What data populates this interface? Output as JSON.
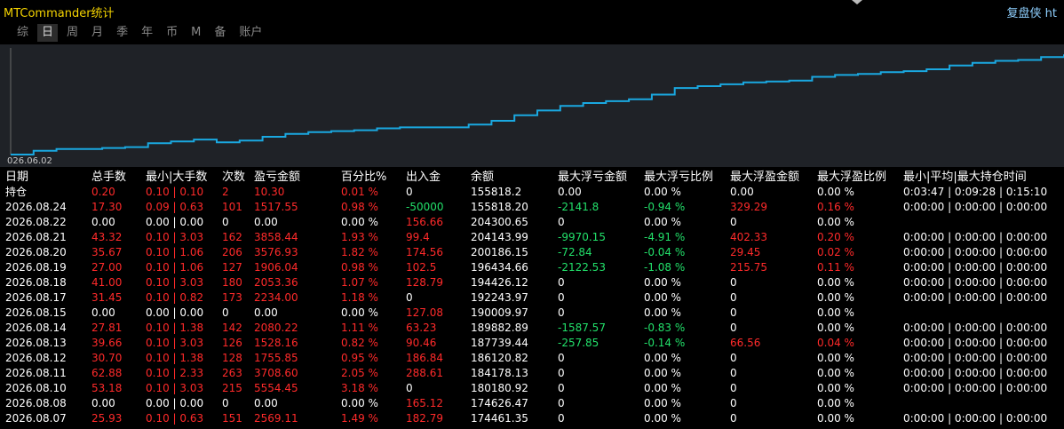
{
  "app": {
    "title": "MTCommander统计",
    "brand": "复盘侠 ht"
  },
  "tabs": [
    {
      "label": "综",
      "active": false
    },
    {
      "label": "日",
      "active": true
    },
    {
      "label": "周",
      "active": false
    },
    {
      "label": "月",
      "active": false
    },
    {
      "label": "季",
      "active": false
    },
    {
      "label": "年",
      "active": false
    },
    {
      "label": "币",
      "active": false
    },
    {
      "label": "M",
      "active": false
    },
    {
      "label": "备",
      "active": false
    },
    {
      "label": "账户",
      "active": false
    }
  ],
  "chart_data": {
    "type": "line",
    "x_start_label": "026.06.02",
    "line_color": "#1aa8e0",
    "background": "#1f2227",
    "values": [
      0,
      4,
      6,
      6,
      7,
      8,
      12,
      14,
      16,
      13,
      15,
      19,
      22,
      24,
      25,
      26,
      28,
      29,
      29,
      29,
      32,
      36,
      42,
      47,
      52,
      55,
      57,
      59,
      64,
      71,
      73,
      75,
      77,
      78,
      79,
      83,
      85,
      86,
      88,
      89,
      91,
      95,
      98,
      100,
      101,
      104,
      107
    ],
    "ylim": [
      0,
      110
    ]
  },
  "table": {
    "headers": [
      "日期",
      "总手数",
      "最小|大手数",
      "次数",
      "盈亏金额",
      "百分比%",
      "出入金",
      "余额",
      "最大浮亏金额",
      "最大浮亏比例",
      "最大浮盈金额",
      "最大浮盈比例",
      "最小|平均|最大持仓时间"
    ],
    "colors": {
      "red": "#ff2a2a",
      "green": "#22e06a",
      "white": "#ffffff"
    },
    "rows": [
      {
        "cells": [
          "持仓",
          "0.20",
          "0.10 | 0.10",
          "2",
          "10.30",
          "0.01 %",
          "0",
          "155818.2",
          "0.00",
          "0.00 %",
          "0.00",
          "0.00 %",
          "0:03:47 | 0:09:28 | 0:15:10"
        ],
        "tones": [
          "white",
          "red",
          "red",
          "red",
          "red",
          "red",
          "white",
          "white",
          "white",
          "white",
          "white",
          "white",
          "white"
        ]
      },
      {
        "cells": [
          "2026.08.24",
          "17.30",
          "0.09 | 0.63",
          "101",
          "1517.55",
          "0.98 %",
          "-50000",
          "155818.20",
          "-2141.8",
          "-0.94 %",
          "329.29",
          "0.16 %",
          "0:00:00 | 0:00:00 | 0:00:00"
        ],
        "tones": [
          "white",
          "red",
          "red",
          "red",
          "red",
          "red",
          "green",
          "white",
          "green",
          "green",
          "red",
          "red",
          "white"
        ]
      },
      {
        "cells": [
          "2026.08.22",
          "0.00",
          "0.00 | 0.00",
          "0",
          "0.00",
          "0.00 %",
          "156.66",
          "204300.65",
          "0",
          "0.00 %",
          "0",
          "0.00 %",
          ""
        ],
        "tones": [
          "white",
          "white",
          "white",
          "white",
          "white",
          "white",
          "red",
          "white",
          "white",
          "white",
          "white",
          "white",
          "white"
        ]
      },
      {
        "cells": [
          "2026.08.21",
          "43.32",
          "0.10 | 3.03",
          "162",
          "3858.44",
          "1.93 %",
          "99.4",
          "204143.99",
          "-9970.15",
          "-4.91 %",
          "402.33",
          "0.20 %",
          "0:00:00 | 0:00:00 | 0:00:00"
        ],
        "tones": [
          "white",
          "red",
          "red",
          "red",
          "red",
          "red",
          "red",
          "white",
          "green",
          "green",
          "red",
          "red",
          "white"
        ]
      },
      {
        "cells": [
          "2026.08.20",
          "35.67",
          "0.10 | 1.06",
          "206",
          "3576.93",
          "1.82 %",
          "174.56",
          "200186.15",
          "-72.84",
          "-0.04 %",
          "29.45",
          "0.02 %",
          "0:00:00 | 0:00:00 | 0:00:00"
        ],
        "tones": [
          "white",
          "red",
          "red",
          "red",
          "red",
          "red",
          "red",
          "white",
          "green",
          "green",
          "red",
          "red",
          "white"
        ]
      },
      {
        "cells": [
          "2026.08.19",
          "27.00",
          "0.10 | 1.06",
          "127",
          "1906.04",
          "0.98 %",
          "102.5",
          "196434.66",
          "-2122.53",
          "-1.08 %",
          "215.75",
          "0.11 %",
          "0:00:00 | 0:00:00 | 0:00:00"
        ],
        "tones": [
          "white",
          "red",
          "red",
          "red",
          "red",
          "red",
          "red",
          "white",
          "green",
          "green",
          "red",
          "red",
          "white"
        ]
      },
      {
        "cells": [
          "2026.08.18",
          "41.00",
          "0.10 | 3.03",
          "180",
          "2053.36",
          "1.07 %",
          "128.79",
          "194426.12",
          "0",
          "0.00 %",
          "0",
          "0.00 %",
          "0:00:00 | 0:00:00 | 0:00:00"
        ],
        "tones": [
          "white",
          "red",
          "red",
          "red",
          "red",
          "red",
          "red",
          "white",
          "white",
          "white",
          "white",
          "white",
          "white"
        ]
      },
      {
        "cells": [
          "2026.08.17",
          "31.45",
          "0.10 | 0.82",
          "173",
          "2234.00",
          "1.18 %",
          "0",
          "192243.97",
          "0",
          "0.00 %",
          "0",
          "0.00 %",
          "0:00:00 | 0:00:00 | 0:00:00"
        ],
        "tones": [
          "white",
          "red",
          "red",
          "red",
          "red",
          "red",
          "white",
          "white",
          "white",
          "white",
          "white",
          "white",
          "white"
        ]
      },
      {
        "cells": [
          "2026.08.15",
          "0.00",
          "0.00 | 0.00",
          "0",
          "0.00",
          "0.00 %",
          "127.08",
          "190009.97",
          "0",
          "0.00 %",
          "0",
          "0.00 %",
          ""
        ],
        "tones": [
          "white",
          "white",
          "white",
          "white",
          "white",
          "white",
          "red",
          "white",
          "white",
          "white",
          "white",
          "white",
          "white"
        ]
      },
      {
        "cells": [
          "2026.08.14",
          "27.81",
          "0.10 | 1.38",
          "142",
          "2080.22",
          "1.11 %",
          "63.23",
          "189882.89",
          "-1587.57",
          "-0.83 %",
          "0",
          "0.00 %",
          "0:00:00 | 0:00:00 | 0:00:00"
        ],
        "tones": [
          "white",
          "red",
          "red",
          "red",
          "red",
          "red",
          "red",
          "white",
          "green",
          "green",
          "white",
          "white",
          "white"
        ]
      },
      {
        "cells": [
          "2026.08.13",
          "39.66",
          "0.10 | 3.03",
          "126",
          "1528.16",
          "0.82 %",
          "90.46",
          "187739.44",
          "-257.85",
          "-0.14 %",
          "66.56",
          "0.04 %",
          "0:00:00 | 0:00:00 | 0:00:00"
        ],
        "tones": [
          "white",
          "red",
          "red",
          "red",
          "red",
          "red",
          "red",
          "white",
          "green",
          "green",
          "red",
          "red",
          "white"
        ]
      },
      {
        "cells": [
          "2026.08.12",
          "30.70",
          "0.10 | 1.38",
          "128",
          "1755.85",
          "0.95 %",
          "186.84",
          "186120.82",
          "0",
          "0.00 %",
          "0",
          "0.00 %",
          "0:00:00 | 0:00:00 | 0:00:00"
        ],
        "tones": [
          "white",
          "red",
          "red",
          "red",
          "red",
          "red",
          "red",
          "white",
          "white",
          "white",
          "white",
          "white",
          "white"
        ]
      },
      {
        "cells": [
          "2026.08.11",
          "62.88",
          "0.10 | 2.33",
          "263",
          "3708.60",
          "2.05 %",
          "288.61",
          "184178.13",
          "0",
          "0.00 %",
          "0",
          "0.00 %",
          "0:00:00 | 0:00:00 | 0:00:00"
        ],
        "tones": [
          "white",
          "red",
          "red",
          "red",
          "red",
          "red",
          "red",
          "white",
          "white",
          "white",
          "white",
          "white",
          "white"
        ]
      },
      {
        "cells": [
          "2026.08.10",
          "53.18",
          "0.10 | 3.03",
          "215",
          "5554.45",
          "3.18 %",
          "0",
          "180180.92",
          "0",
          "0.00 %",
          "0",
          "0.00 %",
          "0:00:00 | 0:00:00 | 0:00:00"
        ],
        "tones": [
          "white",
          "red",
          "red",
          "red",
          "red",
          "red",
          "white",
          "white",
          "white",
          "white",
          "white",
          "white",
          "white"
        ]
      },
      {
        "cells": [
          "2026.08.08",
          "0.00",
          "0.00 | 0.00",
          "0",
          "0.00",
          "0.00 %",
          "165.12",
          "174626.47",
          "0",
          "0.00 %",
          "0",
          "0.00 %",
          ""
        ],
        "tones": [
          "white",
          "white",
          "white",
          "white",
          "white",
          "white",
          "red",
          "white",
          "white",
          "white",
          "white",
          "white",
          "white"
        ]
      },
      {
        "cells": [
          "2026.08.07",
          "25.93",
          "0.10 | 0.63",
          "151",
          "2569.11",
          "1.49 %",
          "182.79",
          "174461.35",
          "0",
          "0.00 %",
          "0",
          "0.00 %",
          "0:00:00 | 0:00:00 | 0:00:00"
        ],
        "tones": [
          "white",
          "red",
          "red",
          "red",
          "red",
          "red",
          "red",
          "white",
          "white",
          "white",
          "white",
          "white",
          "white"
        ]
      }
    ]
  }
}
